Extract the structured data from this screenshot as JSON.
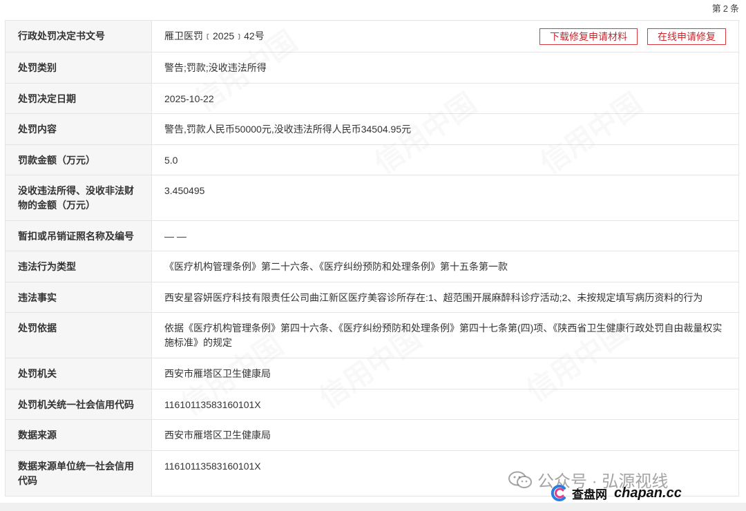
{
  "header": {
    "record_prefix": "第",
    "record_number": "2",
    "record_suffix": "条"
  },
  "actions": {
    "download_label": "下载修复申请材料",
    "apply_label": "在线申请修复"
  },
  "rows": [
    {
      "label": "行政处罚决定书文号",
      "value": "雁卫医罚﹝2025﹞42号"
    },
    {
      "label": "处罚类别",
      "value": "警告;罚款;没收违法所得"
    },
    {
      "label": "处罚决定日期",
      "value": "2025-10-22"
    },
    {
      "label": "处罚内容",
      "value": "警告,罚款人民币50000元,没收违法所得人民币34504.95元"
    },
    {
      "label": "罚款金额（万元）",
      "value": "5.0"
    },
    {
      "label": "没收违法所得、没收非法财物的金额（万元）",
      "value": "3.450495"
    },
    {
      "label": "暂扣或吊销证照名称及编号",
      "value": "— —"
    },
    {
      "label": "违法行为类型",
      "value": "《医疗机构管理条例》第二十六条、《医疗纠纷预防和处理条例》第十五条第一款"
    },
    {
      "label": "违法事实",
      "value": "西安星容妍医疗科技有限责任公司曲江新区医疗美容诊所存在:1、超范围开展麻醉科诊疗活动;2、未按规定填写病历资料的行为"
    },
    {
      "label": "处罚依据",
      "value": "依据《医疗机构管理条例》第四十六条、《医疗纠纷预防和处理条例》第四十七条第(四)项、《陕西省卫生健康行政处罚自由裁量权实施标准》的规定"
    },
    {
      "label": "处罚机关",
      "value": "西安市雁塔区卫生健康局"
    },
    {
      "label": "处罚机关统一社会信用代码",
      "value": "11610113583160101X"
    },
    {
      "label": "数据来源",
      "value": "西安市雁塔区卫生健康局"
    },
    {
      "label": "数据来源单位统一社会信用代码",
      "value": "11610113583160101X"
    }
  ],
  "watermark": {
    "text": "信用中国"
  },
  "overlay_brand": {
    "wechat_text": "公众号 · 弘源视线",
    "site_cn": "查盘网",
    "site_en": "chapan.cc"
  },
  "colors": {
    "button_border": "#d9383e",
    "label_bg": "#f6f6f6",
    "border": "#e4e4e4"
  }
}
